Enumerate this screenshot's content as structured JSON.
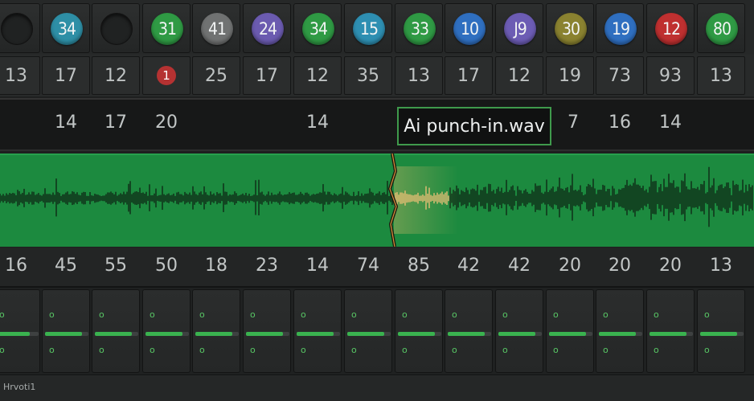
{
  "track_badges": [
    {
      "value": "",
      "color": ""
    },
    {
      "value": "34",
      "color": "#2e8fa6"
    },
    {
      "value": "",
      "color": ""
    },
    {
      "value": "31",
      "color": "#2f9a44"
    },
    {
      "value": "41",
      "color": "#707272"
    },
    {
      "value": "24",
      "color": "#6b5bb0"
    },
    {
      "value": "34",
      "color": "#2f9a44"
    },
    {
      "value": "15",
      "color": "#2e8fb2"
    },
    {
      "value": "33",
      "color": "#2f9a44"
    },
    {
      "value": "10",
      "color": "#2f6fc0"
    },
    {
      "value": "J9",
      "color": "#6c5cb4"
    },
    {
      "value": "30",
      "color": "#8a8230"
    },
    {
      "value": "19",
      "color": "#2f6fc0"
    },
    {
      "value": "12",
      "color": "#bf3030"
    },
    {
      "value": "80",
      "color": "#2f9a44"
    }
  ],
  "row2_values": [
    "13",
    "17",
    "12",
    "1",
    "25",
    "17",
    "12",
    "35",
    "13",
    "17",
    "12",
    "19",
    "73",
    "93",
    "13"
  ],
  "row3_values": [
    "14",
    "17",
    "20",
    "14",
    "7",
    "16",
    "14"
  ],
  "clip_label": "Ai punch-in.wav",
  "row5_values": [
    "16",
    "45",
    "55",
    "50",
    "18",
    "23",
    "14",
    "74",
    "85",
    "42",
    "42",
    "20",
    "20",
    "20",
    "13"
  ],
  "mixer": {
    "top_indicator": "o",
    "bottom_indicator": "o",
    "fader_levels": [
      0.8,
      0.85,
      0.85,
      0.85,
      0.85,
      0.85,
      0.85,
      0.85,
      0.85,
      0.85,
      0.85,
      0.85,
      0.85,
      0.85,
      0.85
    ]
  },
  "status_text": "Hrvoti1",
  "colors": {
    "waveform_bg": "#1c8a3f",
    "punch_marker": "#f0a040",
    "label_border": "#3f9a4c"
  }
}
